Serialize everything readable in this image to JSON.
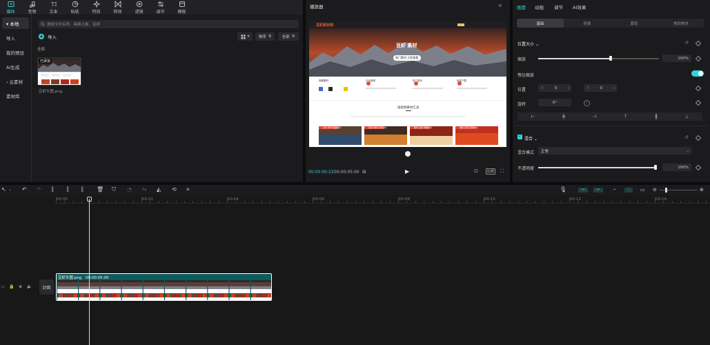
{
  "top_toolbar": {
    "items": [
      {
        "label": "媒体",
        "icon": "media-icon",
        "active": true
      },
      {
        "label": "音频",
        "icon": "audio-icon"
      },
      {
        "label": "文本",
        "icon": "text-icon"
      },
      {
        "label": "贴纸",
        "icon": "sticker-icon"
      },
      {
        "label": "特效",
        "icon": "effects-icon"
      },
      {
        "label": "转场",
        "icon": "transition-icon"
      },
      {
        "label": "滤镜",
        "icon": "filter-icon"
      },
      {
        "label": "调节",
        "icon": "adjust-icon"
      },
      {
        "label": "模板",
        "icon": "template-icon"
      }
    ]
  },
  "sidebar": {
    "items": [
      {
        "label": "▾ 本地",
        "active": true
      },
      {
        "label": "导入"
      },
      {
        "label": "我的预设"
      },
      {
        "label": "AI生成"
      },
      {
        "label": "› 云素材"
      },
      {
        "label": "素材库"
      }
    ]
  },
  "library": {
    "search_placeholder": "搜索文件名称、画面元素、音频",
    "import_label": "导入",
    "sort_label": "排序",
    "filter_label": "全部",
    "section_all": "全部",
    "thumb_badge": "已添加",
    "thumb_name": "豆虾头图.png"
  },
  "player": {
    "title": "播放器",
    "current_time": "00:00:00:23",
    "total_time": "00:00:05:00",
    "ratio_label": "比例",
    "preview": {
      "site_name": "豆虾素材网",
      "hero_title": "豆虾 素材",
      "hero_button": "热门素材 立即查看",
      "section_title": "短视频素材汇总",
      "feature_items": [
        "视频素材",
        "行业新闻",
        "热门资讯",
        "免费下载"
      ],
      "thumb_titles": [
        "山水 风景 航拍素材",
        "夜景 城市 灯光素材",
        "国风 古风 传统素材",
        "党建 红色 宣传素材"
      ]
    }
  },
  "props": {
    "tabs": [
      "画面",
      "动画",
      "调节",
      "AI效果"
    ],
    "active_tab": "画面",
    "subtabs": [
      "基础",
      "抠像",
      "蒙版",
      "美颜美体"
    ],
    "section_position": "位置大小",
    "scale_label": "缩放",
    "scale_value": "100%",
    "scale_fraction": 0.6,
    "uniform_scale_label": "等比缩放",
    "position_label": "位置",
    "pos_x_prefix": "X",
    "pos_x": "0",
    "pos_y_prefix": "Y",
    "pos_y": "0",
    "rotate_label": "旋转",
    "rotate_value": "0°",
    "section_blend": "混合",
    "blend_mode_label": "混合模式",
    "blend_mode_value": "正常",
    "opacity_label": "不透明度",
    "opacity_value": "100%",
    "opacity_fraction": 1.0
  },
  "timeline": {
    "ticks": [
      "00:00",
      "00:02",
      "00:04",
      "00:06",
      "00:08",
      "00:10",
      "00:12",
      "00:14"
    ],
    "clip_name": "豆虾头图.png",
    "clip_duration": "00:00:05:00",
    "cover_label": "封面"
  },
  "colors": {
    "accent": "#38d1d7",
    "clip": "#0f5a5c"
  }
}
